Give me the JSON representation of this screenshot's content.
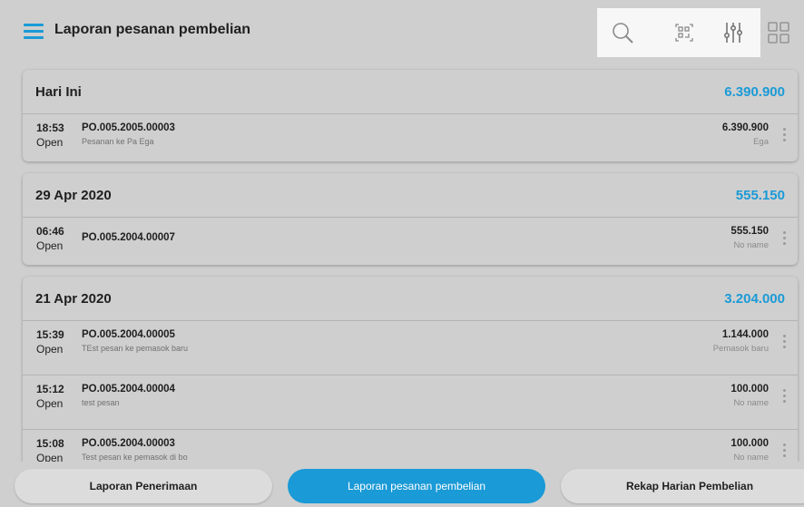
{
  "header": {
    "title": "Laporan pesanan pembelian",
    "icons": [
      "menu-icon",
      "search-icon",
      "barcode-scan-icon",
      "filter-sliders-icon",
      "grid-view-icon"
    ]
  },
  "colors": {
    "accent": "#1a9ad6",
    "background": "#cfcfcf",
    "toolbox": "#f7f7f7"
  },
  "sections": [
    {
      "date": "Hari Ini",
      "total": "6.390.900",
      "rows": [
        {
          "time": "18:53",
          "status": "Open",
          "po": "PO.005.2005.00003",
          "desc": "Pesanan ke Pa Ega",
          "amount": "6.390.900",
          "supplier": "Ega"
        }
      ]
    },
    {
      "date": "29 Apr 2020",
      "total": "555.150",
      "rows": [
        {
          "time": "06:46",
          "status": "Open",
          "po": "PO.005.2004.00007",
          "desc": "",
          "amount": "555.150",
          "supplier": "No name"
        }
      ]
    },
    {
      "date": "21 Apr 2020",
      "total": "3.204.000",
      "rows": [
        {
          "time": "15:39",
          "status": "Open",
          "po": "PO.005.2004.00005",
          "desc": "TEst pesan ke pemasok baru",
          "amount": "1.144.000",
          "supplier": "Pemasok baru"
        },
        {
          "time": "15:12",
          "status": "Open",
          "po": "PO.005.2004.00004",
          "desc": "test pesan",
          "amount": "100.000",
          "supplier": "No name"
        },
        {
          "time": "15:08",
          "status": "Open",
          "po": "PO.005.2004.00003",
          "desc": "Test pesan ke pemasok di bo",
          "amount": "100.000",
          "supplier": "No name"
        }
      ]
    }
  ],
  "tabs": [
    {
      "label": "Laporan Penerimaan",
      "active": false
    },
    {
      "label": "Laporan pesanan pembelian",
      "active": true
    },
    {
      "label": "Rekap Harian Pembelian",
      "active": false
    }
  ]
}
